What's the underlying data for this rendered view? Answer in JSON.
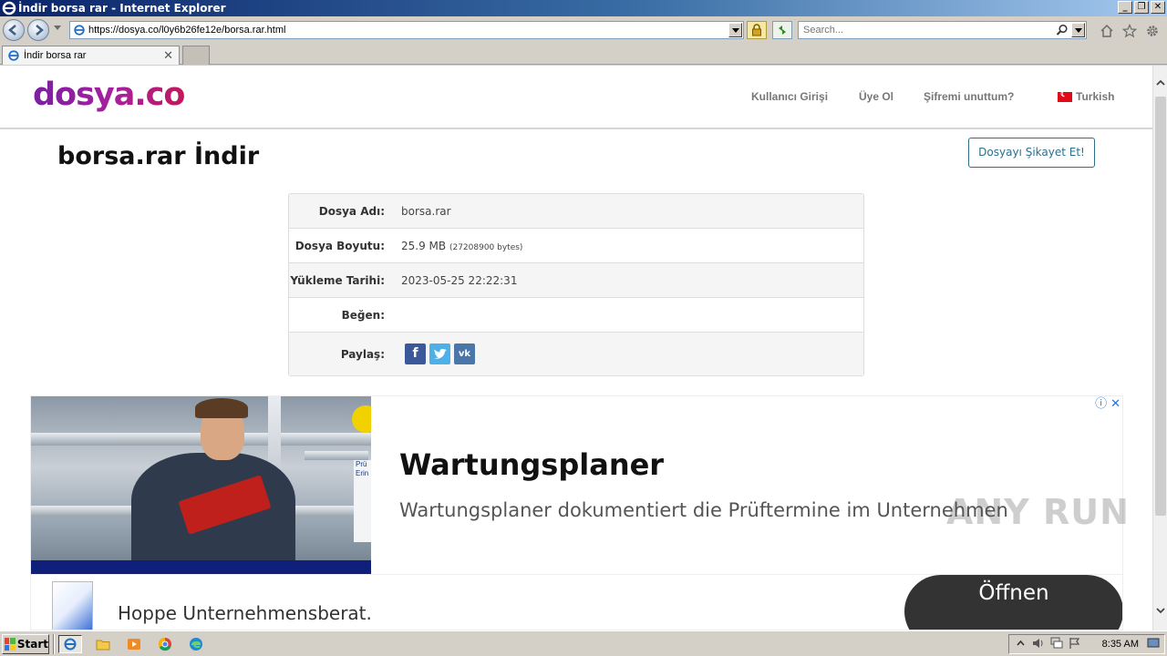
{
  "window": {
    "title": "İndir borsa rar - Internet Explorer",
    "controls": [
      "_",
      "❐",
      "✕"
    ]
  },
  "navbar": {
    "url": "https://dosya.co/l0y6b26fe12e/borsa.rar.html",
    "search_placeholder": "Search..."
  },
  "tabs": [
    {
      "label": "İndir borsa rar",
      "close": "✕"
    }
  ],
  "site": {
    "logo": "dosya.co",
    "nav": {
      "login": "Kullanıcı Girişi",
      "register": "Üye Ol",
      "forgot": "Şifremi unuttum?",
      "language": "Turkish"
    },
    "page_title": "borsa.rar İndir",
    "complain_button": "Dosyayı Şikayet Et!"
  },
  "file_info": {
    "rows": [
      {
        "key": "Dosya Adı:",
        "value": "borsa.rar"
      },
      {
        "key": "Dosya Boyutu:",
        "value": "25.9 MB",
        "sub": "(27208900 bytes)"
      },
      {
        "key": "Yükleme Tarihi:",
        "value": "2023-05-25 22:22:31"
      },
      {
        "key": "Beğen:",
        "value": ""
      },
      {
        "key": "Paylaş:",
        "value": ""
      }
    ],
    "share": [
      {
        "name": "facebook",
        "glyph": "f"
      },
      {
        "name": "twitter",
        "glyph": "t"
      },
      {
        "name": "vk",
        "glyph": "vk"
      }
    ]
  },
  "ad": {
    "title": "Wartungsplaner",
    "description": "Wartungsplaner dokumentiert die Prüftermine im Unternehmen",
    "advertiser": "Hoppe Unternehmensberat.",
    "button": "Öffnen",
    "sign_text": "Prü Erin",
    "info_icons": [
      "ⓘ",
      "✕"
    ]
  },
  "watermark": "ANY RUN",
  "taskbar": {
    "start": "Start",
    "clock": "8:35 AM"
  },
  "colors": {
    "accent": "#2b6f8c",
    "logo_gradient_start": "#7b1fa2",
    "logo_gradient_end": "#c2185b",
    "titlebar": "#0a246a"
  }
}
